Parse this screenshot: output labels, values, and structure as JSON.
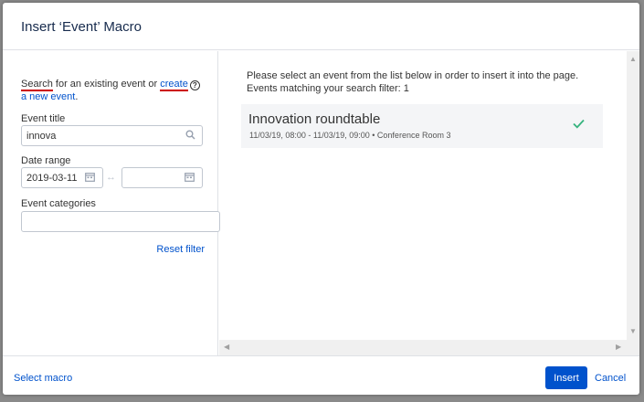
{
  "dialog": {
    "title": "Insert ‘Event’ Macro"
  },
  "left_panel": {
    "intro_search": "Search",
    "intro_middle": " for an existing event or ",
    "intro_create": "create",
    "intro_new_event": "a new event",
    "intro_end": ".",
    "help_icon": "?",
    "event_title_label": "Event title",
    "event_title_value": "innova",
    "date_range_label": "Date range",
    "date_from_value": "2019-03-11",
    "date_to_value": "",
    "date_range_separator": "↔",
    "event_categories_label": "Event categories",
    "event_categories_value": "",
    "reset_filter": "Reset filter"
  },
  "right_panel": {
    "instruction": "Please select an event from the list below in order to insert it into the page.",
    "match_count_text": "Events matching your search filter: 1",
    "events": [
      {
        "name": "Innovation roundtable",
        "meta": "11/03/19, 08:00 - 11/03/19, 09:00 • Conference Room 3",
        "selected": true
      }
    ]
  },
  "footer": {
    "select_macro": "Select macro",
    "insert": "Insert",
    "cancel": "Cancel"
  },
  "colors": {
    "link": "#0052cc",
    "primary_button": "#0052cc",
    "check": "#36b37e",
    "annotation_underline": "#cc0000"
  },
  "icons": [
    "search-icon",
    "calendar-icon",
    "help-icon",
    "checkmark-icon"
  ]
}
